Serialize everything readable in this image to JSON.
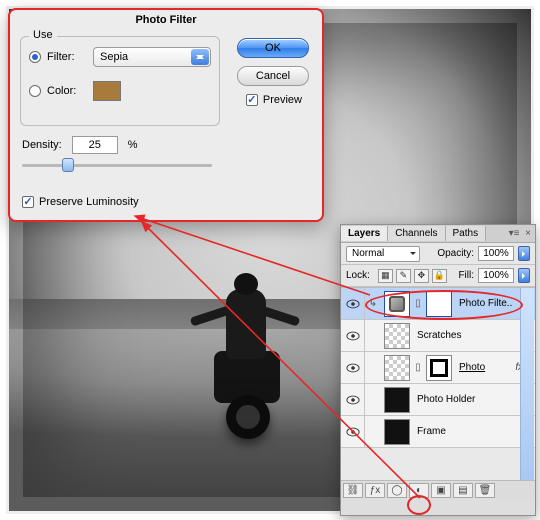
{
  "dialog": {
    "title": "Photo Filter",
    "use_legend": "Use",
    "filter_label": "Filter:",
    "filter_value": "Sepia",
    "color_label": "Color:",
    "color_swatch": "#a87b3d",
    "density_label": "Density:",
    "density_value": "25",
    "density_unit": "%",
    "preserve_label": "Preserve Luminosity",
    "ok": "OK",
    "cancel": "Cancel",
    "preview": "Preview"
  },
  "panel": {
    "tabs": [
      "Layers",
      "Channels",
      "Paths"
    ],
    "blend_mode": "Normal",
    "opacity_label": "Opacity:",
    "opacity_value": "100%",
    "lock_label": "Lock:",
    "fill_label": "Fill:",
    "fill_value": "100%",
    "layers": [
      {
        "name": "Photo Filte..",
        "kind": "adjustment",
        "selected": true
      },
      {
        "name": "Scratches",
        "kind": "raster"
      },
      {
        "name": "Photo",
        "kind": "masked-image",
        "fx": true,
        "underline": true
      },
      {
        "name": "Photo Holder",
        "kind": "black"
      },
      {
        "name": "Frame",
        "kind": "black"
      }
    ],
    "fx_label": "fx"
  }
}
